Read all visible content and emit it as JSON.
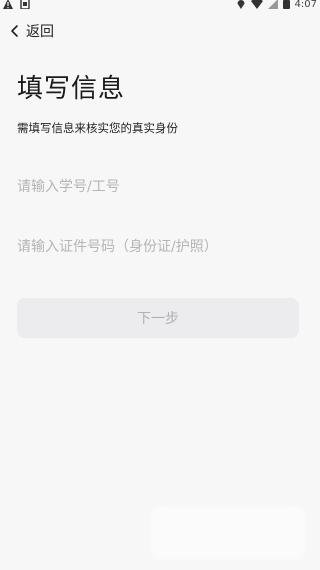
{
  "status_bar": {
    "time": "4:07",
    "icons_left": [
      "warning-icon",
      "notification-icon"
    ],
    "icons_right": [
      "location-icon",
      "wifi-icon",
      "signal-icon",
      "battery-icon"
    ]
  },
  "nav": {
    "back_label": "返回"
  },
  "page": {
    "title": "填写信息",
    "subtitle": "需填写信息来核实您的真实身份"
  },
  "form": {
    "id_placeholder": "请输入学号/工号",
    "id_value": "",
    "cert_placeholder": "请输入证件号码（身份证/护照）",
    "cert_value": ""
  },
  "actions": {
    "next_label": "下一步"
  }
}
